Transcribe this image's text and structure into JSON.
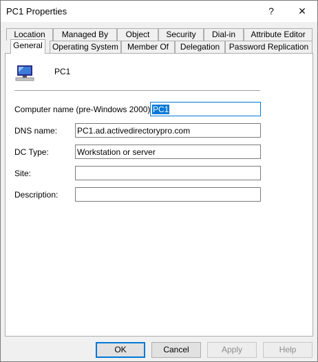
{
  "window": {
    "title": "PC1 Properties",
    "help_glyph": "?",
    "close_glyph": "✕"
  },
  "tabs_row1": [
    {
      "label": "Location"
    },
    {
      "label": "Managed By"
    },
    {
      "label": "Object"
    },
    {
      "label": "Security"
    },
    {
      "label": "Dial-in"
    },
    {
      "label": "Attribute Editor"
    }
  ],
  "tabs_row2": [
    {
      "label": "General",
      "active": true
    },
    {
      "label": "Operating System"
    },
    {
      "label": "Member Of"
    },
    {
      "label": "Delegation"
    },
    {
      "label": "Password Replication"
    }
  ],
  "general": {
    "computer_icon": "computer-icon",
    "computer_name": "PC1",
    "fields": {
      "prewin2000": {
        "label": "Computer name (pre-Windows 2000):",
        "value": "PC1"
      },
      "dns": {
        "label": "DNS name:",
        "value": "PC1.ad.activedirectorypro.com"
      },
      "dctype": {
        "label": "DC Type:",
        "value": "Workstation or server"
      },
      "site": {
        "label": "Site:",
        "value": ""
      },
      "description": {
        "label": "Description:",
        "value": ""
      }
    }
  },
  "buttons": {
    "ok": "OK",
    "cancel": "Cancel",
    "apply": "Apply",
    "help": "Help"
  },
  "colors": {
    "accent": "#0078d7",
    "disabled_text": "#8c8c8c"
  }
}
